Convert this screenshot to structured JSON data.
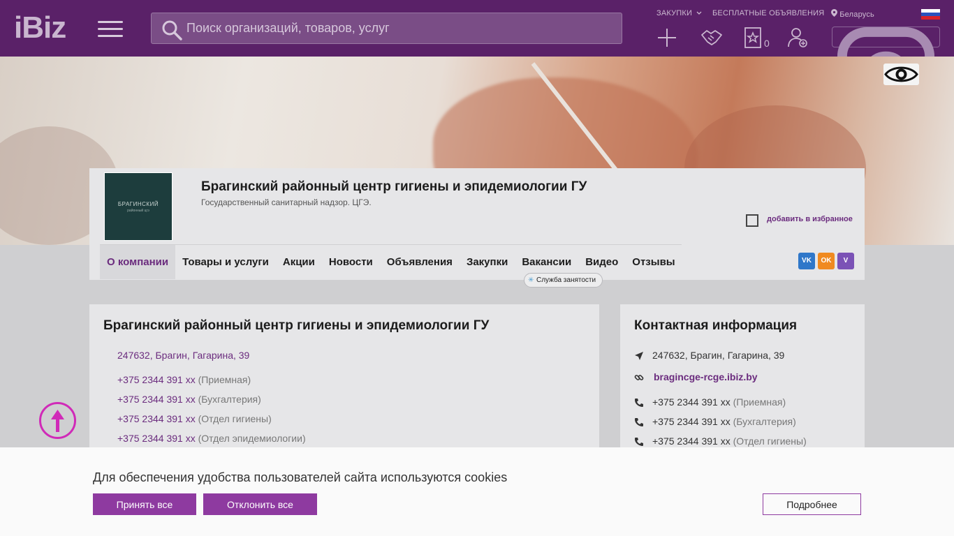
{
  "header": {
    "logo": "iBiz",
    "search_placeholder": "Поиск организаций, товаров, услуг",
    "links": {
      "purchases": "ЗАКУПКИ",
      "free_ads": "БЕСПЛАТНЫЕ ОБЪЯВЛЕНИЯ",
      "region": "Беларусь"
    },
    "favorites_count": "0",
    "icons": [
      "add-icon",
      "handshake-icon",
      "favorites-star-icon",
      "add-user-icon"
    ],
    "social_icons": [
      "instagram-icon",
      "vk-icon",
      "youtube-icon",
      "telegram-icon"
    ]
  },
  "company": {
    "logo_text_1": "БРАГИНСКИЙ",
    "logo_text_2": "районный цгэ",
    "name": "Брагинский районный центр гигиены и эпидемиологии ГУ",
    "description": "Государственный санитарный надзор. ЦГЭ.",
    "add_favorite": "добавить в избранное",
    "tabs": [
      {
        "label": "О компании",
        "active": true
      },
      {
        "label": "Товары и услуги"
      },
      {
        "label": "Акции"
      },
      {
        "label": "Новости"
      },
      {
        "label": "Объявления"
      },
      {
        "label": "Закупки"
      },
      {
        "label": "Вакансии"
      },
      {
        "label": "Видео"
      },
      {
        "label": "Отзывы"
      }
    ],
    "vacancy_badge": "Служба занятости",
    "share": [
      {
        "name": "vk-share-icon",
        "label": "VK",
        "color": "#2f77c9"
      },
      {
        "name": "ok-share-icon",
        "label": "OK",
        "color": "#f08a20"
      },
      {
        "name": "viber-share-icon",
        "label": "V",
        "color": "#7b52b6"
      }
    ]
  },
  "about": {
    "title": "Брагинский районный центр гигиены и эпидемиологии ГУ",
    "address": "247632, Брагин, Гагарина, 39",
    "phones": [
      {
        "number": "+375 2344 391 xx",
        "dept": "(Приемная)"
      },
      {
        "number": "+375 2344 391 xx",
        "dept": "(Бухгалтерия)"
      },
      {
        "number": "+375 2344 391 xx",
        "dept": "(Отдел гигиены)"
      },
      {
        "number": "+375 2344 391 xx",
        "dept": "(Отдел эпидемиологии)"
      }
    ]
  },
  "contacts": {
    "title": "Контактная информация",
    "address": "247632, Брагин, Гагарина, 39",
    "site": "bragincge-rcge.ibiz.by",
    "phones": [
      {
        "number": "+375 2344 391 xx",
        "dept": "(Приемная)"
      },
      {
        "number": "+375 2344 391 xx",
        "dept": "(Бухгалтерия)"
      },
      {
        "number": "+375 2344 391 xx",
        "dept": "(Отдел гигиены)"
      }
    ]
  },
  "cookie": {
    "text": "Для обеспечения удобства пользователей сайта используются cookies",
    "accept": "Принять все",
    "reject": "Отклонить все",
    "details": "Подробнее"
  },
  "colors": {
    "header": "#5a2168",
    "accent": "#6b2c7e",
    "button": "#8e3aa0"
  }
}
